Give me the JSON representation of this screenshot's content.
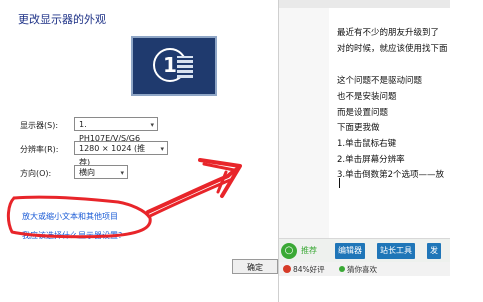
{
  "display_settings": {
    "title": "更改显示器的外观",
    "monitor_number": "1",
    "display_label": "显示器(S):",
    "display_value": "1. PH107E/V/S/G6",
    "resolution_label": "分辨率(R):",
    "resolution_value": "1280 × 1024 (推荐)",
    "orientation_label": "方向(O):",
    "orientation_value": "横向",
    "link_advanced": "放大或缩小文本和其他项目",
    "link_which": "我应该选择什么显示器设置?",
    "ok_label": "确定"
  },
  "editor": {
    "lines": [
      "最近有不少的朋友升级到了",
      "对的时候，就应该使用找下面",
      "",
      "这个问题不是驱动问题",
      "          也不是安装问题",
      "          而是设置问题",
      "下面更我做",
      "1.单击鼠标右键",
      "2.单击屏幕分辨率",
      "3.单击倒数第2个选项——放"
    ],
    "toolbar": {
      "recommend": "推荐",
      "editor_btn": "编辑器",
      "webmaster_btn": "站长工具",
      "more_btn": "发"
    },
    "status": {
      "rating": "84%好评",
      "guess": "猜你喜欢"
    }
  },
  "colors": {
    "link": "#1a5bd6",
    "annotation": "#e8252a",
    "toolbar_button": "#1f76b8",
    "accent_green": "#3aa935"
  }
}
